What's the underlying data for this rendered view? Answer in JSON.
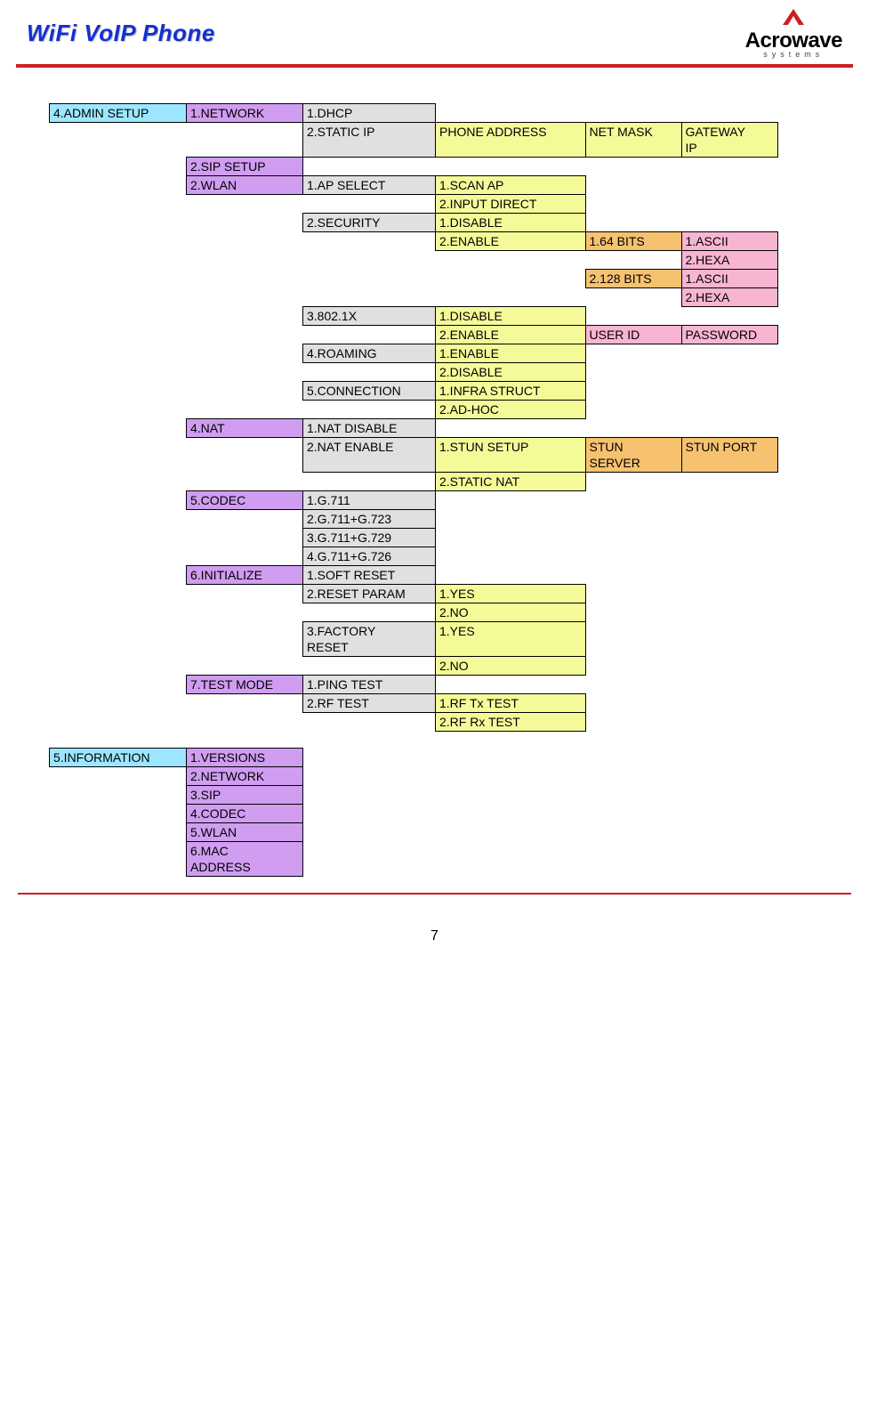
{
  "header": {
    "title": "WiFi VoIP Phone",
    "logo_main": "Acrowave",
    "logo_sub": "systems"
  },
  "footer": {
    "page": "7"
  },
  "admin": {
    "root": "4.ADMIN SETUP",
    "network": {
      "label": "1.NETWORK",
      "dhcp": "1.DHCP",
      "static_ip": {
        "label": "2.STATIC IP",
        "phone_addr": "PHONE ADDRESS",
        "net_mask": "NET MASK",
        "gateway_ip": "GATEWAY IP"
      }
    },
    "sip_setup": "2.SIP SETUP",
    "wlan": {
      "label": "2.WLAN",
      "ap_select": {
        "label": "1.AP SELECT",
        "scan": "1.SCAN AP",
        "input": "2.INPUT DIRECT"
      },
      "security": {
        "label": "2.SECURITY",
        "disable": "1.DISABLE",
        "enable": "2.ENABLE",
        "b64": "1.64 BITS",
        "b128": "2.128 BITS",
        "ascii": "1.ASCII",
        "hexa": "2.HEXA"
      },
      "dot1x": {
        "label": "3.802.1X",
        "disable": "1.DISABLE",
        "enable": "2.ENABLE",
        "user": "USER ID",
        "pass": "PASSWORD"
      },
      "roaming": {
        "label": "4.ROAMING",
        "enable": "1.ENABLE",
        "disable": "2.DISABLE"
      },
      "conn": {
        "label": "5.CONNECTION",
        "infra": "1.INFRA STRUCT",
        "adhoc": "2.AD-HOC"
      }
    },
    "nat": {
      "label": "4.NAT",
      "disable": "1.NAT DISABLE",
      "enable": {
        "label": "2.NAT ENABLE",
        "stun": "1.STUN SETUP",
        "stun_server": "STUN SERVER",
        "stun_port": "STUN PORT",
        "static_nat": "2.STATIC NAT"
      }
    },
    "codec": {
      "label": "5.CODEC",
      "g711": "1.G.711",
      "g711_723": "2.G.711+G.723",
      "g711_729": "3.G.711+G.729",
      "g711_726": "4.G.711+G.726"
    },
    "init": {
      "label": "6.INITIALIZE",
      "soft": "1.SOFT RESET",
      "reset_param": {
        "label": "2.RESET PARAM",
        "yes": "1.YES",
        "no": "2.NO"
      },
      "factory": {
        "label": "3.FACTORY RESET",
        "yes": "1.YES",
        "no": "2.NO"
      }
    },
    "test": {
      "label": "7.TEST MODE",
      "ping": "1.PING TEST",
      "rf": {
        "label": "2.RF TEST",
        "tx": "1.RF Tx TEST",
        "rx": "2.RF Rx TEST"
      }
    }
  },
  "info": {
    "root": "5.INFORMATION",
    "versions": "1.VERSIONS",
    "network": "2.NETWORK",
    "sip": "3.SIP",
    "codec": "4.CODEC",
    "wlan": "5.WLAN",
    "mac": "6.MAC ADDRESS"
  }
}
